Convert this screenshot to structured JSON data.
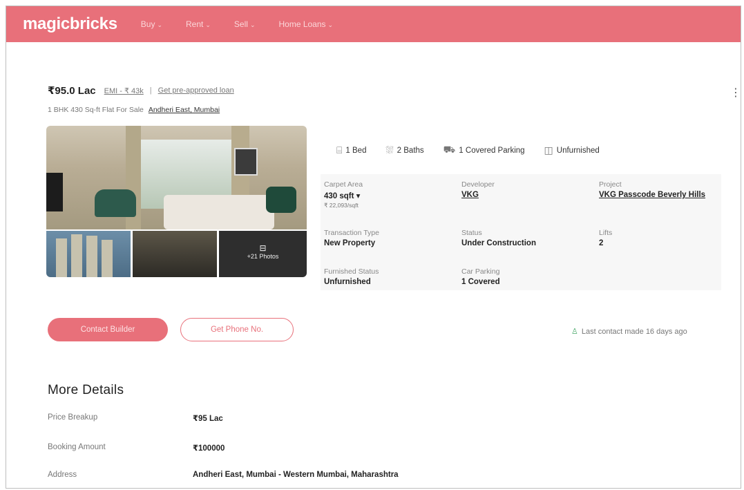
{
  "nav": {
    "logo": "magicbricks",
    "items": [
      {
        "label": "Buy"
      },
      {
        "label": "Rent"
      },
      {
        "label": "Sell"
      },
      {
        "label": "Home Loans"
      }
    ]
  },
  "listing": {
    "price": "₹95.0 Lac",
    "emi": "EMI - ₹ 43k",
    "separator": "|",
    "loan_link": "Get pre-approved loan",
    "subtitle": "1 BHK 430 Sq-ft Flat For Sale",
    "location": "Andheri East, Mumbai",
    "menu_icon": "⋮"
  },
  "photos": {
    "more_label": "+21 Photos",
    "camera_icon": "camera-icon"
  },
  "amenities": [
    {
      "icon": "bed-icon",
      "glyph": "⌸",
      "label": "1 Bed"
    },
    {
      "icon": "bath-icon",
      "glyph": "⛆",
      "label": "2 Baths"
    },
    {
      "icon": "parking-icon",
      "glyph": "⛟",
      "label": "1 Covered Parking"
    },
    {
      "icon": "furniture-icon",
      "glyph": "◫",
      "label": "Unfurnished"
    }
  ],
  "details": {
    "carpet_area": {
      "label": "Carpet Area",
      "value": "430 sqft ▾",
      "sub": "₹ 22,093/sqft"
    },
    "developer": {
      "label": "Developer",
      "value": "VKG"
    },
    "project": {
      "label": "Project",
      "value": "VKG Passcode Beverly Hills"
    },
    "transaction_type": {
      "label": "Transaction Type",
      "value": "New Property"
    },
    "status": {
      "label": "Status",
      "value": "Under Construction"
    },
    "lifts": {
      "label": "Lifts",
      "value": "2"
    },
    "furnished_status": {
      "label": "Furnished Status",
      "value": "Unfurnished"
    },
    "car_parking": {
      "label": "Car Parking",
      "value": "1 Covered"
    }
  },
  "actions": {
    "contact_builder": "Contact Builder",
    "get_phone": "Get Phone No.",
    "last_contact": "Last contact made 16 days ago"
  },
  "more_details": {
    "title": "More Details",
    "rows": [
      {
        "key": "Price Breakup",
        "value": "₹95 Lac"
      },
      {
        "key": "Booking Amount",
        "value": "₹100000"
      },
      {
        "key": "Address",
        "value": "Andheri East, Mumbai - Western Mumbai, Maharashtra"
      }
    ]
  },
  "colors": {
    "brand": "#e8707a",
    "panel": "#f7f7f7"
  }
}
